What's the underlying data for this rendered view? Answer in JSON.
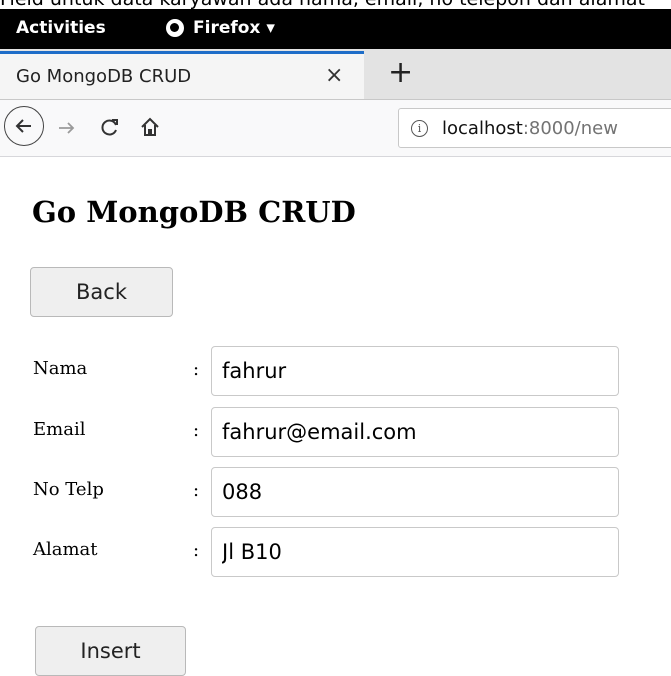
{
  "caption": "Field untuk data karyawan ada nama, email, no telepon dan alamat",
  "os": {
    "activities": "Activities",
    "app_menu": "Firefox ▾"
  },
  "browser": {
    "tab_title": "Go MongoDB CRUD",
    "tab_close": "×",
    "new_tab": "+",
    "url_host": "localhost",
    "url_path": ":8000/new"
  },
  "page": {
    "title": "Go MongoDB CRUD",
    "back_label": "Back",
    "insert_label": "Insert",
    "fields": [
      {
        "label": "Nama",
        "value": "fahrur"
      },
      {
        "label": "Email",
        "value": "fahrur@email.com"
      },
      {
        "label": "No Telp",
        "value": "088"
      },
      {
        "label": "Alamat",
        "value": "Jl B10"
      }
    ],
    "separator": ":"
  }
}
